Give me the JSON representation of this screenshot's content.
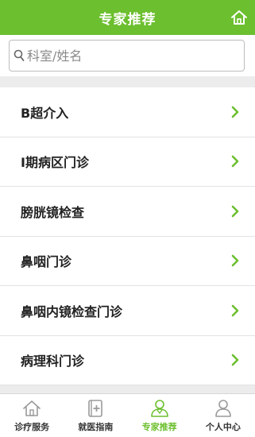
{
  "header": {
    "title": "专家推荐",
    "home_icon": "home-icon"
  },
  "search": {
    "placeholder": "科室/姓名",
    "value": "",
    "icon": "search-icon"
  },
  "departments": [
    {
      "label": "B超介入"
    },
    {
      "label": "I期病区门诊"
    },
    {
      "label": "膀胱镜检查"
    },
    {
      "label": "鼻咽门诊"
    },
    {
      "label": "鼻咽内镜检查门诊"
    },
    {
      "label": "病理科门诊"
    }
  ],
  "tabbar": {
    "tabs": [
      {
        "label": "诊疗服务",
        "icon": "house-icon",
        "active": false
      },
      {
        "label": "就医指南",
        "icon": "guide-book-icon",
        "active": false
      },
      {
        "label": "专家推荐",
        "icon": "doctor-icon",
        "active": true
      },
      {
        "label": "个人中心",
        "icon": "person-icon",
        "active": false
      }
    ]
  },
  "colors": {
    "brand": "#6cbf2e",
    "list_background": "#ececec",
    "inactive_icon": "#9a9a9a"
  }
}
